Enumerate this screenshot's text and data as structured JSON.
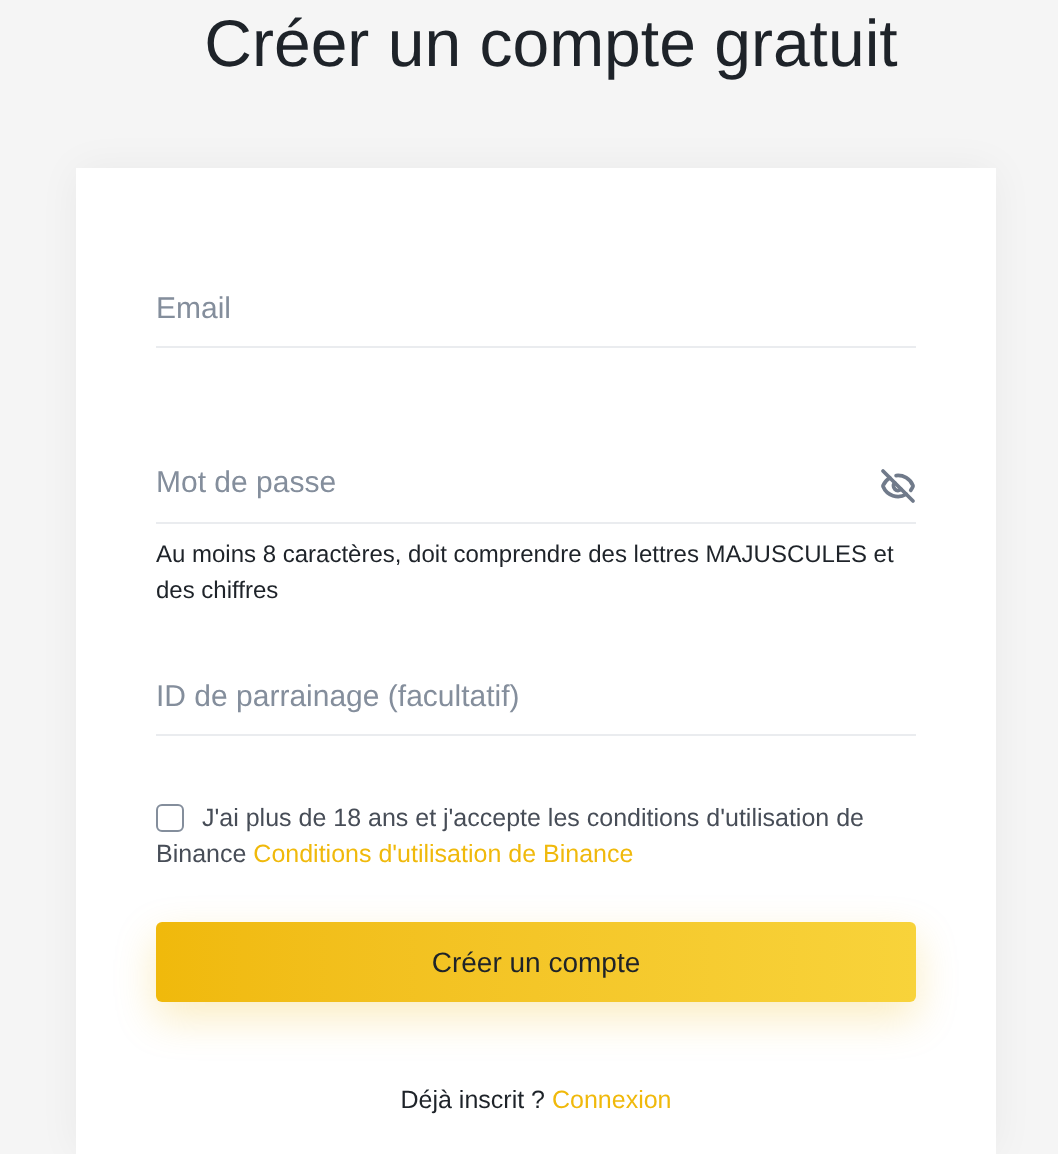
{
  "title": "Créer un compte gratuit",
  "fields": [
    {
      "kind": "text",
      "placeholder": "Email"
    },
    {
      "kind": "password",
      "placeholder": "Mot de passe",
      "hint": "Au moins 8 caractères, doit comprendre des lettres MAJUSCULES et des chiffres"
    },
    {
      "kind": "text",
      "placeholder": "ID de parrainage (facultatif)"
    }
  ],
  "terms": {
    "checked": false,
    "text": "J'ai plus de 18 ans et j'accepte les conditions d'utilisation de Binance",
    "link": "Conditions d'utilisation de Binance"
  },
  "submit": "Créer un compte",
  "login": {
    "text": "Déjà inscrit ?",
    "link": "Connexion"
  }
}
